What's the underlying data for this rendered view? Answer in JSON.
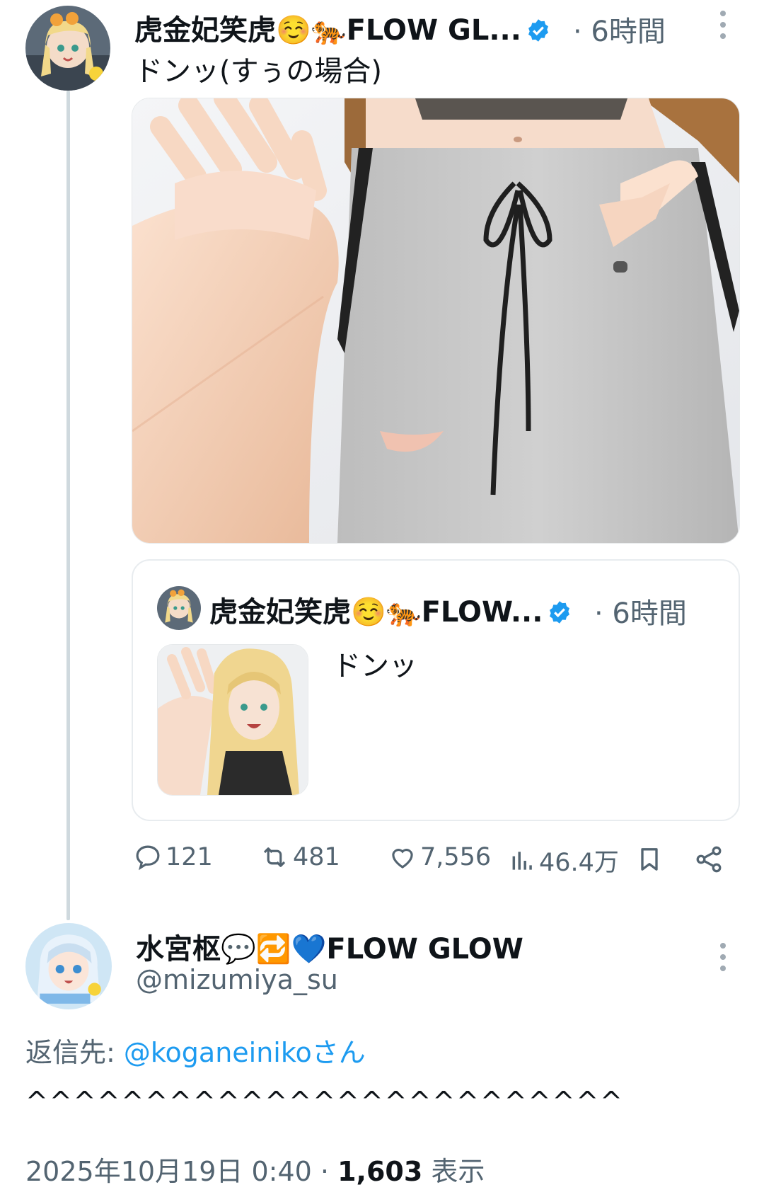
{
  "tweet": {
    "author_name": "虎金妃笑虎☺️🐅FLOW GL...",
    "time": "· 6時間",
    "text": "ドンッ(すぅの場合)",
    "quote": {
      "author_name": "虎金妃笑虎☺️🐅FLOW...",
      "time": "· 6時間",
      "text": "ドンッ"
    },
    "actions": {
      "replies": "121",
      "retweets": "481",
      "likes": "7,556",
      "views": "46.4万"
    }
  },
  "reply": {
    "author_name": "水宮枢💬🔁💙FLOW GLOW",
    "handle": "@mizumiya_su",
    "reply_to_label": "返信先: ",
    "reply_to_handle": "@koganeinikoさん",
    "text": "^^^^^^^^^^^^^^^^^^^^^^^^^",
    "timestamp": "2025年10月19日 0:40 · ",
    "views_count": "1,603",
    "views_label": " 表示"
  },
  "colors": {
    "accent": "#1d9bf0",
    "muted": "#536471",
    "thread_line": "#cfd9de"
  },
  "icons": [
    "verified-badge-icon",
    "more-options-icon",
    "reply-icon",
    "retweet-icon",
    "like-icon",
    "views-icon",
    "bookmark-icon",
    "share-icon"
  ]
}
